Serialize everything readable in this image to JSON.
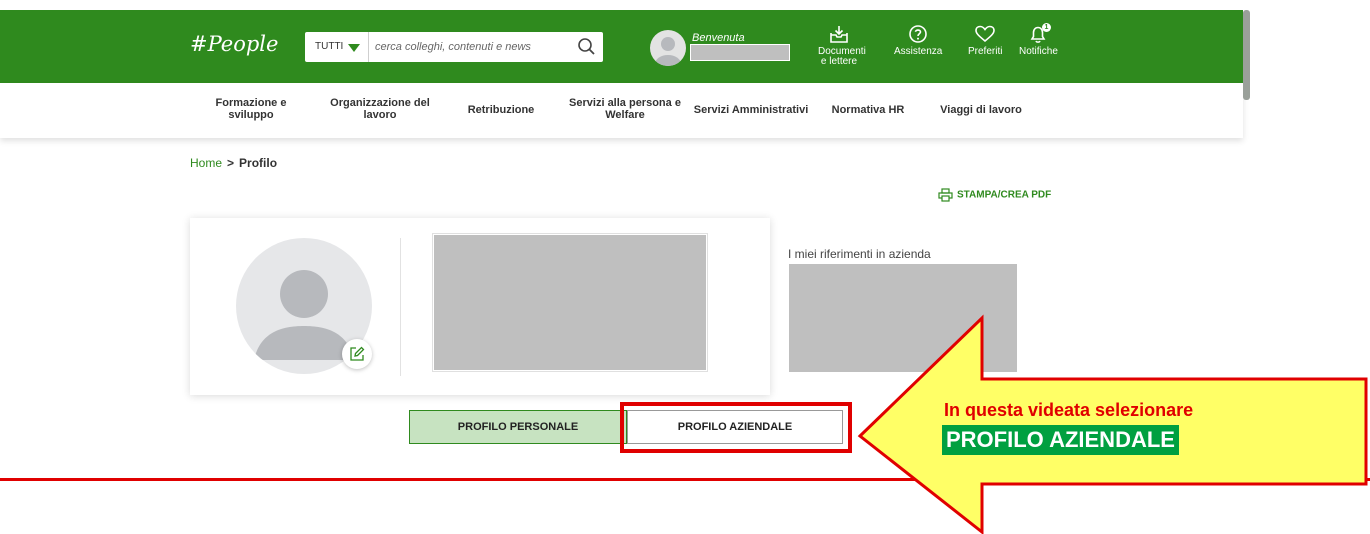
{
  "header": {
    "logo": "#People",
    "search": {
      "filter_label": "TUTTI",
      "placeholder": "cerca colleghi, contenuti e news"
    },
    "welcome": "Benvenuta",
    "actions": {
      "documents": "Documenti e lettere",
      "support": "Assistenza",
      "favorites": "Preferiti",
      "notifications": "Notifiche",
      "notifications_badge": "1"
    }
  },
  "nav": {
    "items": [
      "Formazione e sviluppo",
      "Organizzazione del lavoro",
      "Retribuzione",
      "Servizi alla persona e Welfare",
      "Servizi Amministrativi",
      "Normativa HR",
      "Viaggi di lavoro"
    ]
  },
  "breadcrumb": {
    "home": "Home",
    "separator": ">",
    "current": "Profilo"
  },
  "print_label": "STAMPA/CREA PDF",
  "references_label": "I miei riferimenti in azienda",
  "tabs": {
    "personal": "PROFILO PERSONALE",
    "company": "PROFILO AZIENDALE"
  },
  "annotation": {
    "line1": "In questa videata selezionare",
    "line2": "PROFILO AZIENDALE"
  },
  "colors": {
    "brand_green": "#2f8a1e",
    "active_tab": "#c7e3c1",
    "annotation_red": "#e00000",
    "arrow_yellow": "#ffff66",
    "label_bg_green": "#00a040"
  },
  "icons": [
    "search-icon",
    "inbox-icon",
    "help-icon",
    "heart-icon",
    "bell-icon",
    "printer-icon",
    "edit-icon",
    "user-silhouette-icon"
  ]
}
